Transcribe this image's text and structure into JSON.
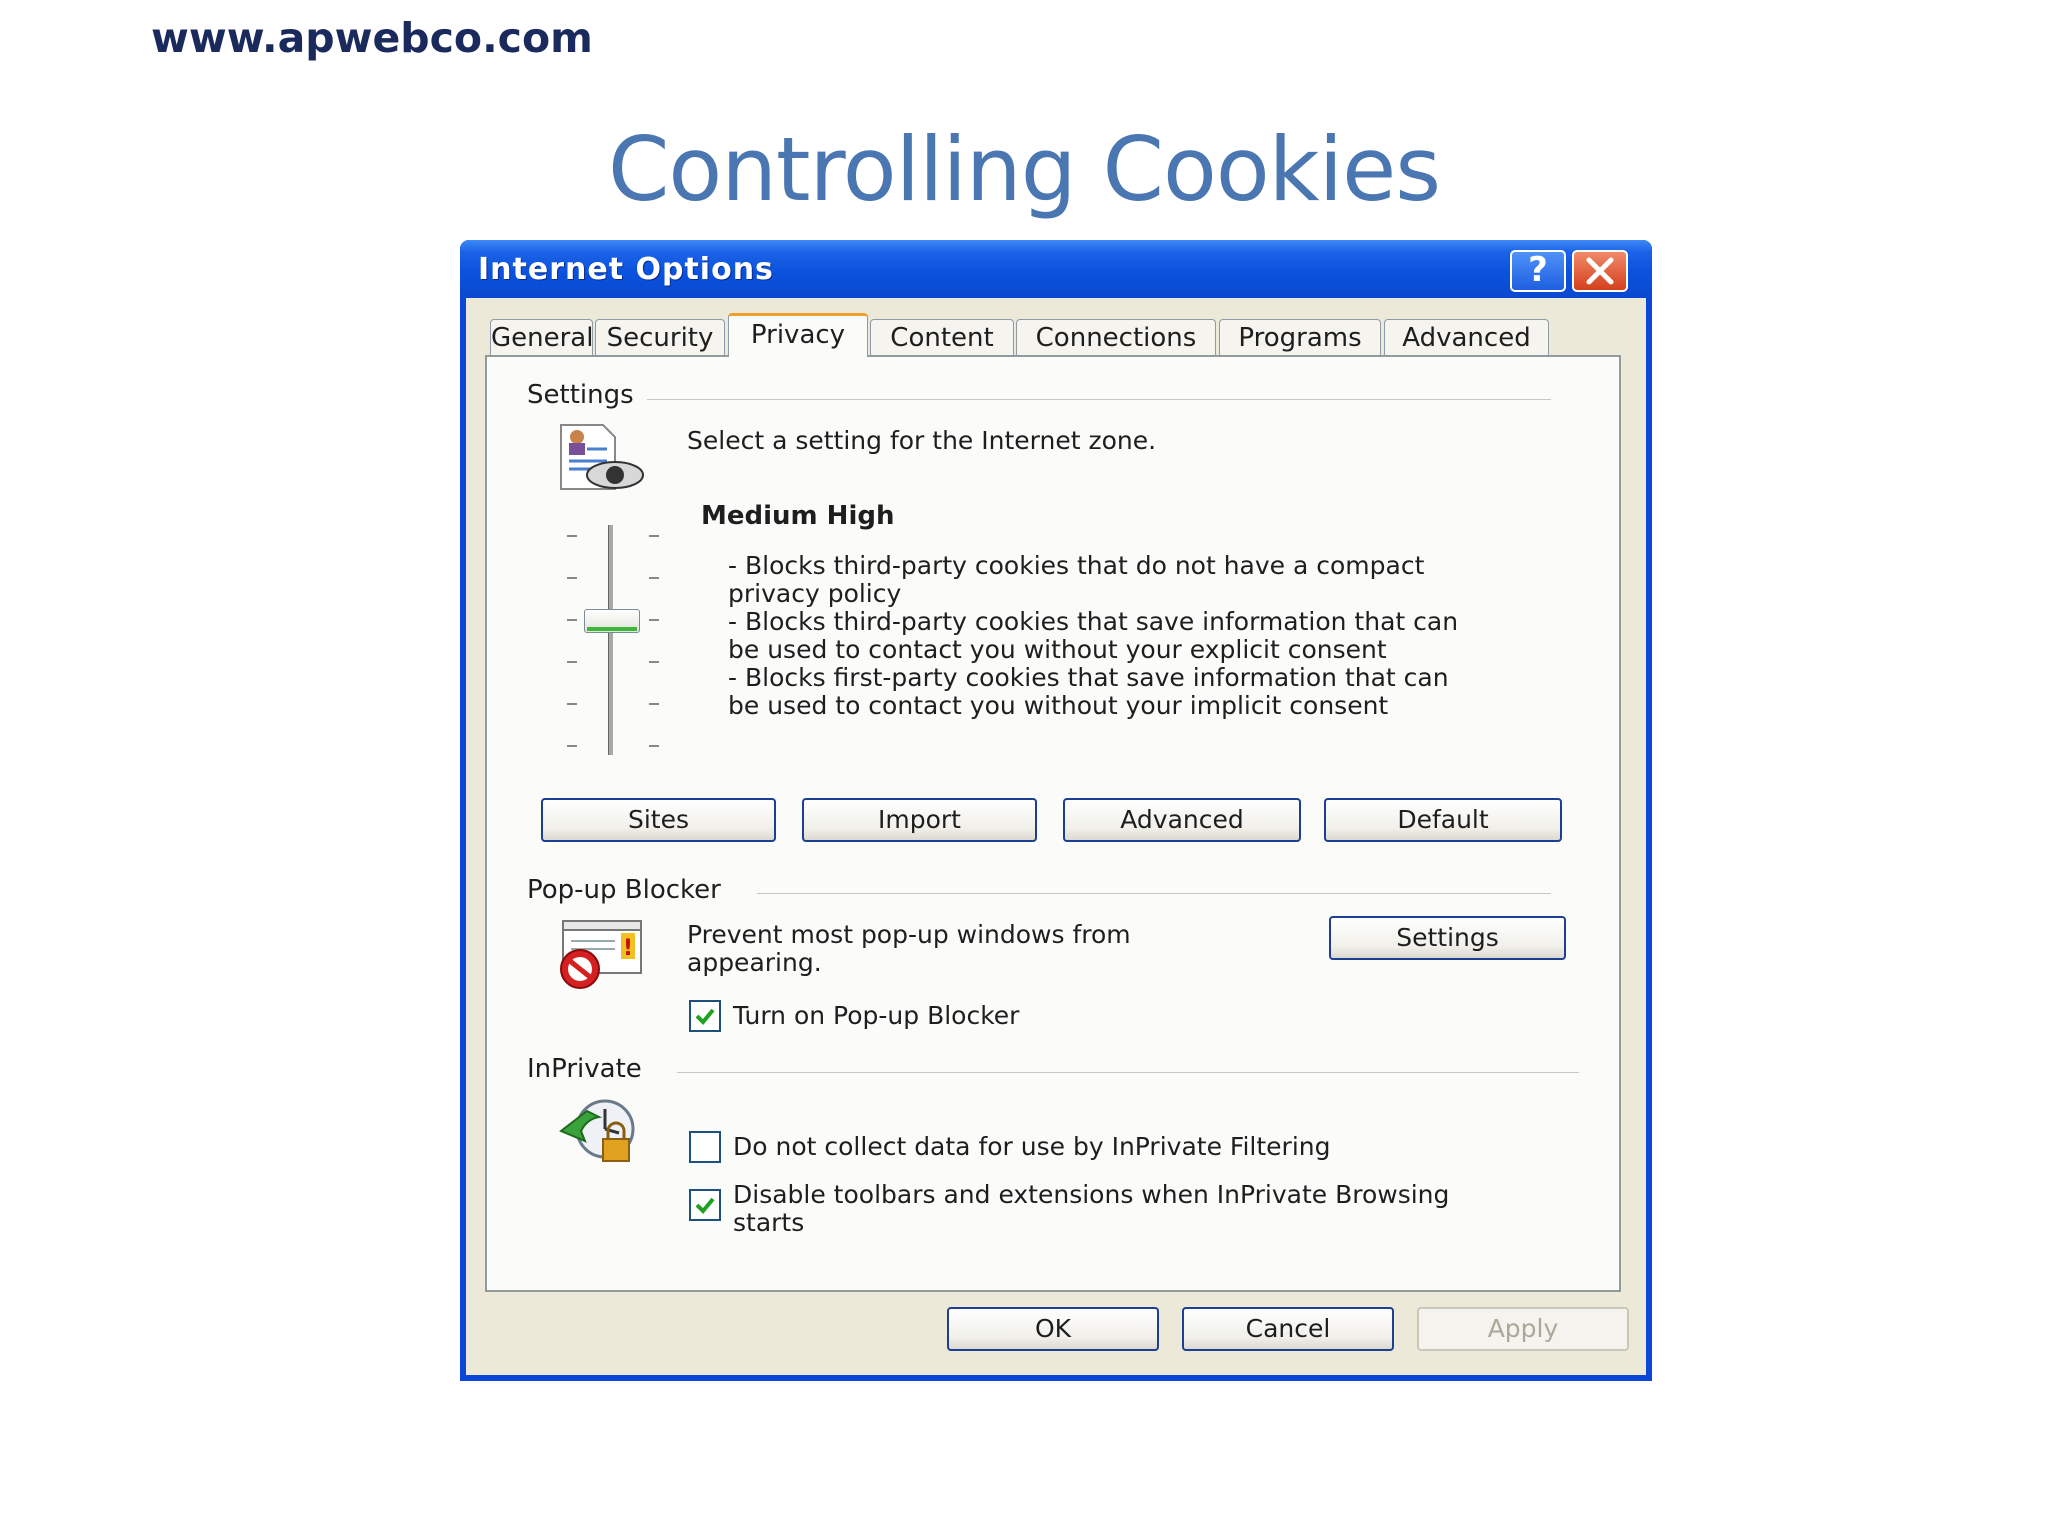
{
  "site_url": "www.apwebco.com",
  "slide_title": "Controlling Cookies",
  "window": {
    "title": "Internet Options",
    "help_glyph": "?",
    "tabs": [
      "General",
      "Security",
      "Privacy",
      "Content",
      "Connections",
      "Programs",
      "Advanced"
    ],
    "active_tab": "Privacy"
  },
  "settings": {
    "group_label": "Settings",
    "zone_text": "Select a setting for the Internet zone.",
    "level": "Medium High",
    "slider_level_index": 3,
    "slider_levels_total": 6,
    "desc_lines": [
      "- Blocks third-party cookies that do not have a compact",
      "privacy policy",
      "- Blocks third-party cookies that save information that can",
      "be used to contact you without your explicit consent",
      "- Blocks first-party cookies that save information that can",
      "be used to contact you without your implicit consent"
    ],
    "buttons": {
      "sites": "Sites",
      "import": "Import",
      "advanced": "Advanced",
      "default": "Default"
    }
  },
  "popup": {
    "group_label": "Pop-up Blocker",
    "desc_line1": "Prevent most pop-up windows from",
    "desc_line2": "appearing.",
    "settings_button": "Settings",
    "checkbox_label": "Turn on Pop-up Blocker",
    "checked": true
  },
  "inprivate": {
    "group_label": "InPrivate",
    "filtering_label": "Do not collect data for use by InPrivate Filtering",
    "filtering_checked": false,
    "disable_label_line1": "Disable toolbars and extensions when InPrivate Browsing",
    "disable_label_line2": "starts",
    "disable_checked": true
  },
  "footer": {
    "ok": "OK",
    "cancel": "Cancel",
    "apply": "Apply"
  },
  "colors": {
    "titlebar": "#0a49cf",
    "dialog_bg": "#ece9d8",
    "slide_title": "#4a76b1",
    "url": "#1b2a5c"
  }
}
